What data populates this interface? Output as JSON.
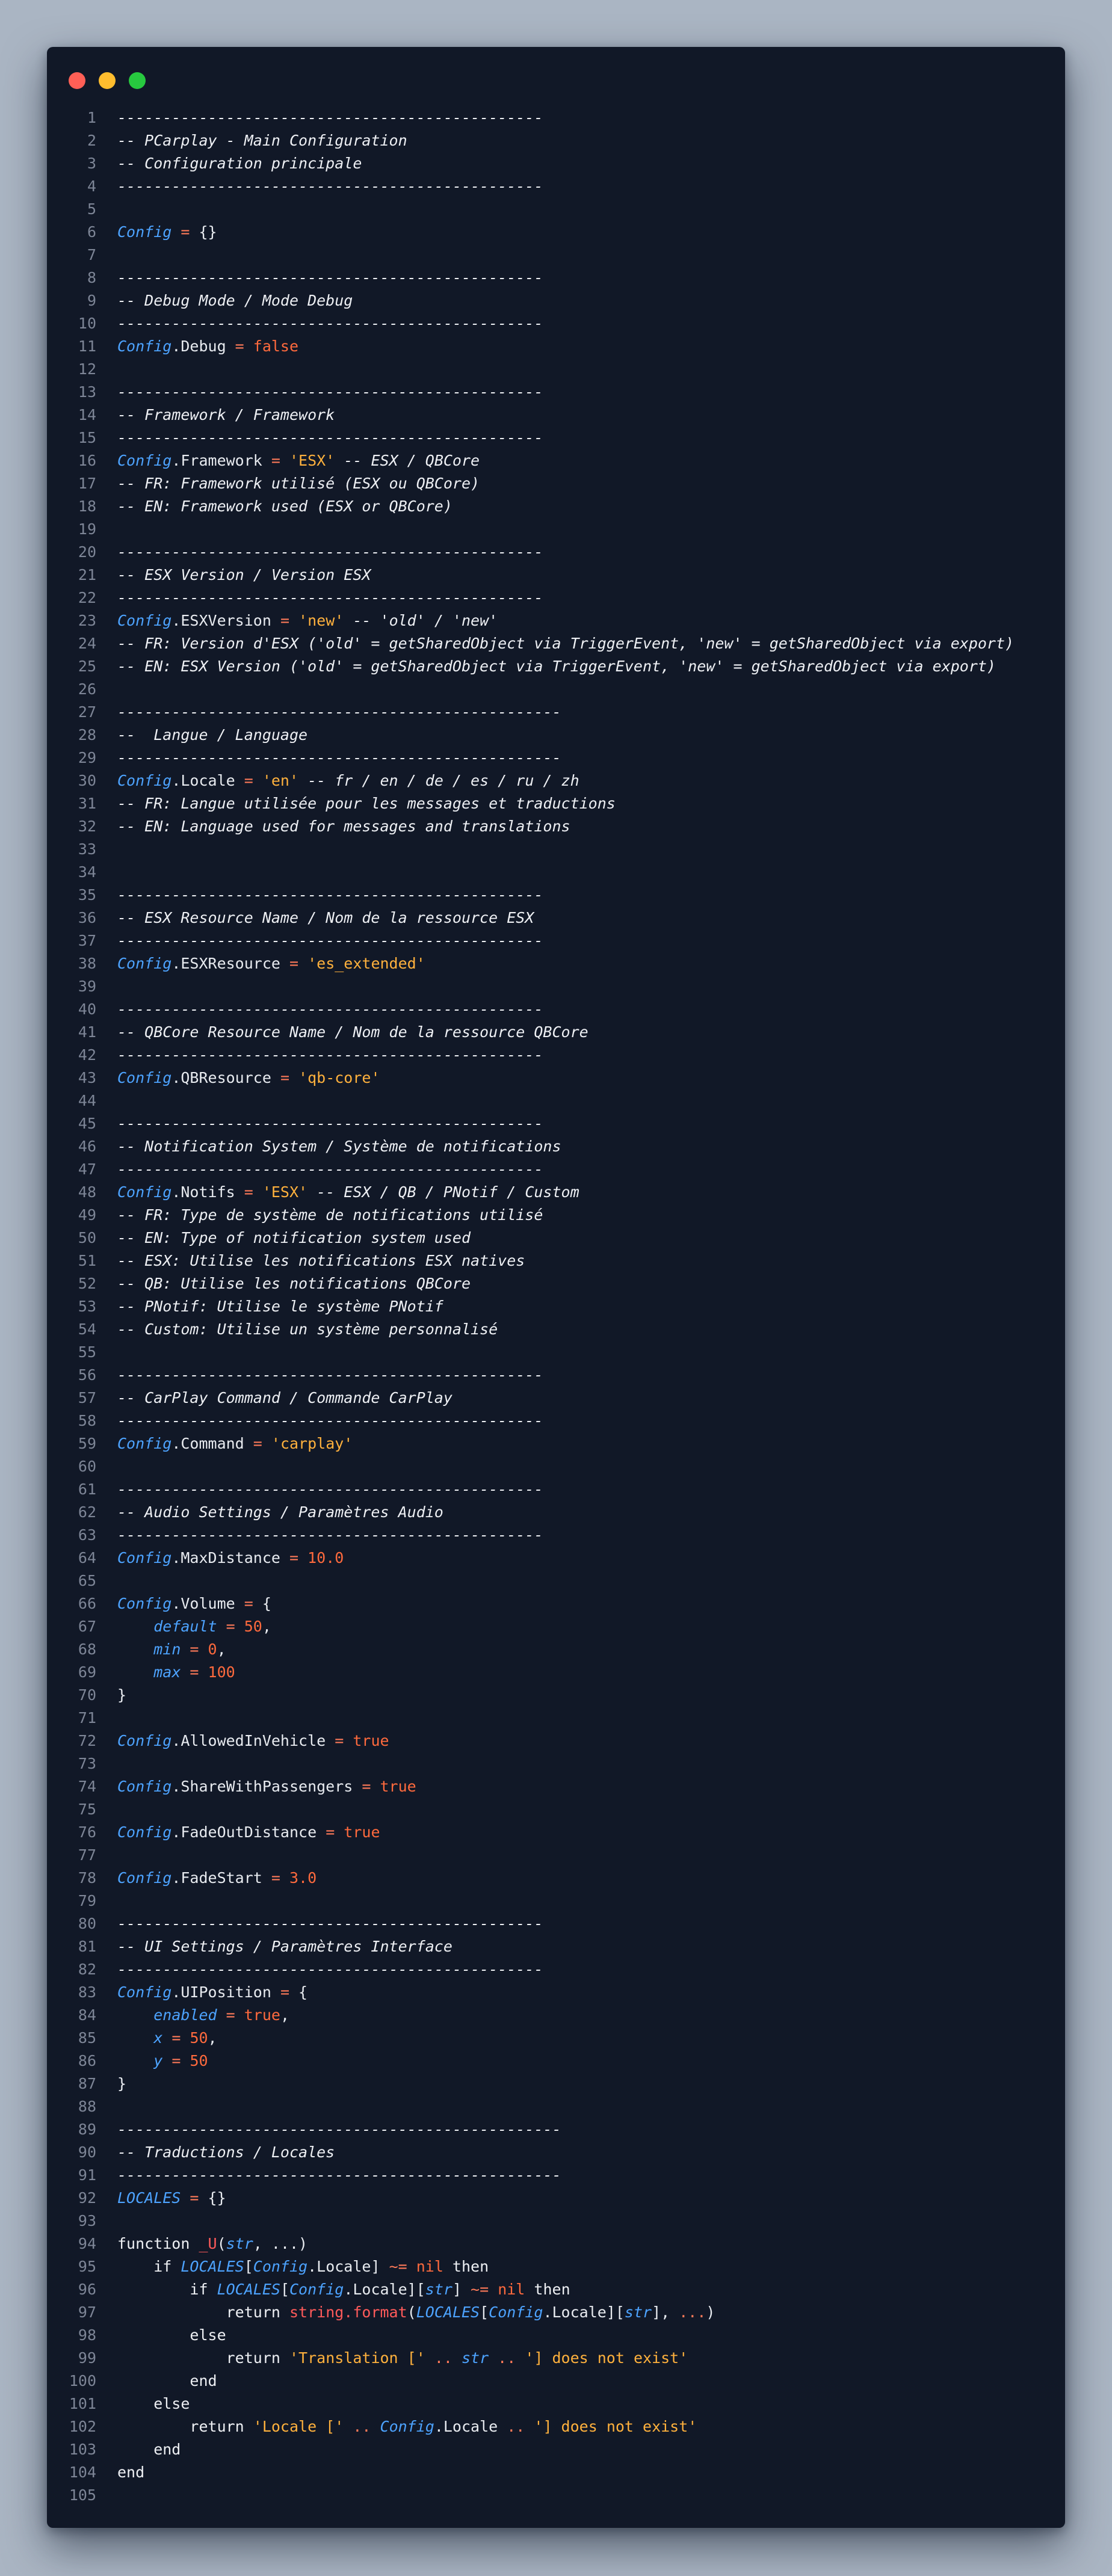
{
  "window": {
    "controls": [
      "close",
      "minimize",
      "maximize"
    ],
    "colors": {
      "close": "#ff5f56",
      "minimize": "#ffbd2e",
      "maximize": "#27c93f",
      "background": "#111827"
    }
  },
  "editor": {
    "lines": [
      [
        [
          "c",
          "-----------------------------------------------"
        ]
      ],
      [
        [
          "c",
          "-- PCarplay - Main Configuration"
        ]
      ],
      [
        [
          "c",
          "-- Configuration principale"
        ]
      ],
      [
        [
          "c",
          "-----------------------------------------------"
        ]
      ],
      [],
      [
        [
          "v",
          "Config"
        ],
        [
          "op",
          " = "
        ],
        [
          "p",
          "{}"
        ]
      ],
      [],
      [
        [
          "c",
          "-----------------------------------------------"
        ]
      ],
      [
        [
          "c",
          "-- Debug Mode / Mode Debug"
        ]
      ],
      [
        [
          "c",
          "-----------------------------------------------"
        ]
      ],
      [
        [
          "v",
          "Config"
        ],
        [
          "p",
          ".Debug"
        ],
        [
          "op",
          " = "
        ],
        [
          "k",
          "false"
        ]
      ],
      [],
      [
        [
          "c",
          "-----------------------------------------------"
        ]
      ],
      [
        [
          "c",
          "-- Framework / Framework"
        ]
      ],
      [
        [
          "c",
          "-----------------------------------------------"
        ]
      ],
      [
        [
          "v",
          "Config"
        ],
        [
          "p",
          ".Framework"
        ],
        [
          "op",
          " = "
        ],
        [
          "s",
          "'ESX'"
        ],
        [
          "c",
          " -- ESX / QBCore"
        ]
      ],
      [
        [
          "c",
          "-- FR: Framework utilisé (ESX ou QBCore)"
        ]
      ],
      [
        [
          "c",
          "-- EN: Framework used (ESX or QBCore)"
        ]
      ],
      [],
      [
        [
          "c",
          "-----------------------------------------------"
        ]
      ],
      [
        [
          "c",
          "-- ESX Version / Version ESX"
        ]
      ],
      [
        [
          "c",
          "-----------------------------------------------"
        ]
      ],
      [
        [
          "v",
          "Config"
        ],
        [
          "p",
          ".ESXVersion"
        ],
        [
          "op",
          " = "
        ],
        [
          "s",
          "'new'"
        ],
        [
          "c",
          " -- 'old' / 'new'"
        ]
      ],
      [
        [
          "c",
          "-- FR: Version d'ESX ('old' = getSharedObject via TriggerEvent, 'new' = getSharedObject via export)"
        ]
      ],
      [
        [
          "c",
          "-- EN: ESX Version ('old' = getSharedObject via TriggerEvent, 'new' = getSharedObject via export)"
        ]
      ],
      [],
      [
        [
          "c",
          "-------------------------------------------------"
        ]
      ],
      [
        [
          "c",
          "--  Langue / Language"
        ]
      ],
      [
        [
          "c",
          "-------------------------------------------------"
        ]
      ],
      [
        [
          "v",
          "Config"
        ],
        [
          "p",
          ".Locale"
        ],
        [
          "op",
          " = "
        ],
        [
          "s",
          "'en'"
        ],
        [
          "c",
          " -- fr / en / de / es / ru / zh"
        ]
      ],
      [
        [
          "c",
          "-- FR: Langue utilisée pour les messages et traductions"
        ]
      ],
      [
        [
          "c",
          "-- EN: Language used for messages and translations"
        ]
      ],
      [],
      [],
      [
        [
          "c",
          "-----------------------------------------------"
        ]
      ],
      [
        [
          "c",
          "-- ESX Resource Name / Nom de la ressource ESX"
        ]
      ],
      [
        [
          "c",
          "-----------------------------------------------"
        ]
      ],
      [
        [
          "v",
          "Config"
        ],
        [
          "p",
          ".ESXResource"
        ],
        [
          "op",
          " = "
        ],
        [
          "s",
          "'es_extended'"
        ]
      ],
      [],
      [
        [
          "c",
          "-----------------------------------------------"
        ]
      ],
      [
        [
          "c",
          "-- QBCore Resource Name / Nom de la ressource QBCore"
        ]
      ],
      [
        [
          "c",
          "-----------------------------------------------"
        ]
      ],
      [
        [
          "v",
          "Config"
        ],
        [
          "p",
          ".QBResource"
        ],
        [
          "op",
          " = "
        ],
        [
          "s",
          "'qb-core'"
        ]
      ],
      [],
      [
        [
          "c",
          "-----------------------------------------------"
        ]
      ],
      [
        [
          "c",
          "-- Notification System / Système de notifications"
        ]
      ],
      [
        [
          "c",
          "-----------------------------------------------"
        ]
      ],
      [
        [
          "v",
          "Config"
        ],
        [
          "p",
          ".Notifs"
        ],
        [
          "op",
          " = "
        ],
        [
          "s",
          "'ESX'"
        ],
        [
          "c",
          " -- ESX / QB / PNotif / Custom"
        ]
      ],
      [
        [
          "c",
          "-- FR: Type de système de notifications utilisé"
        ]
      ],
      [
        [
          "c",
          "-- EN: Type of notification system used"
        ]
      ],
      [
        [
          "c",
          "-- ESX: Utilise les notifications ESX natives"
        ]
      ],
      [
        [
          "c",
          "-- QB: Utilise les notifications QBCore"
        ]
      ],
      [
        [
          "c",
          "-- PNotif: Utilise le système PNotif"
        ]
      ],
      [
        [
          "c",
          "-- Custom: Utilise un système personnalisé"
        ]
      ],
      [],
      [
        [
          "c",
          "-----------------------------------------------"
        ]
      ],
      [
        [
          "c",
          "-- CarPlay Command / Commande CarPlay"
        ]
      ],
      [
        [
          "c",
          "-----------------------------------------------"
        ]
      ],
      [
        [
          "v",
          "Config"
        ],
        [
          "p",
          ".Command"
        ],
        [
          "op",
          " = "
        ],
        [
          "s",
          "'carplay'"
        ]
      ],
      [],
      [
        [
          "c",
          "-----------------------------------------------"
        ]
      ],
      [
        [
          "c",
          "-- Audio Settings / Paramètres Audio"
        ]
      ],
      [
        [
          "c",
          "-----------------------------------------------"
        ]
      ],
      [
        [
          "v",
          "Config"
        ],
        [
          "p",
          ".MaxDistance"
        ],
        [
          "op",
          " = "
        ],
        [
          "n",
          "10.0"
        ]
      ],
      [],
      [
        [
          "v",
          "Config"
        ],
        [
          "p",
          ".Volume"
        ],
        [
          "op",
          " = "
        ],
        [
          "p",
          "{"
        ]
      ],
      [
        [
          "p",
          "    "
        ],
        [
          "v",
          "default"
        ],
        [
          "op",
          " = "
        ],
        [
          "n",
          "50"
        ],
        [
          "p",
          ","
        ]
      ],
      [
        [
          "p",
          "    "
        ],
        [
          "v",
          "min"
        ],
        [
          "op",
          " = "
        ],
        [
          "n",
          "0"
        ],
        [
          "p",
          ","
        ]
      ],
      [
        [
          "p",
          "    "
        ],
        [
          "v",
          "max"
        ],
        [
          "op",
          " = "
        ],
        [
          "n",
          "100"
        ]
      ],
      [
        [
          "p",
          "}"
        ]
      ],
      [],
      [
        [
          "v",
          "Config"
        ],
        [
          "p",
          ".AllowedInVehicle"
        ],
        [
          "op",
          " = "
        ],
        [
          "k",
          "true"
        ]
      ],
      [],
      [
        [
          "v",
          "Config"
        ],
        [
          "p",
          ".ShareWithPassengers"
        ],
        [
          "op",
          " = "
        ],
        [
          "k",
          "true"
        ]
      ],
      [],
      [
        [
          "v",
          "Config"
        ],
        [
          "p",
          ".FadeOutDistance"
        ],
        [
          "op",
          " = "
        ],
        [
          "k",
          "true"
        ]
      ],
      [],
      [
        [
          "v",
          "Config"
        ],
        [
          "p",
          ".FadeStart"
        ],
        [
          "op",
          " = "
        ],
        [
          "n",
          "3.0"
        ]
      ],
      [],
      [
        [
          "c",
          "-----------------------------------------------"
        ]
      ],
      [
        [
          "c",
          "-- UI Settings / Paramètres Interface"
        ]
      ],
      [
        [
          "c",
          "-----------------------------------------------"
        ]
      ],
      [
        [
          "v",
          "Config"
        ],
        [
          "p",
          ".UIPosition"
        ],
        [
          "op",
          " = "
        ],
        [
          "p",
          "{"
        ]
      ],
      [
        [
          "p",
          "    "
        ],
        [
          "v",
          "enabled"
        ],
        [
          "op",
          " = "
        ],
        [
          "k",
          "true"
        ],
        [
          "p",
          ","
        ]
      ],
      [
        [
          "p",
          "    "
        ],
        [
          "v",
          "x"
        ],
        [
          "op",
          " = "
        ],
        [
          "n",
          "50"
        ],
        [
          "p",
          ","
        ]
      ],
      [
        [
          "p",
          "    "
        ],
        [
          "v",
          "y"
        ],
        [
          "op",
          " = "
        ],
        [
          "n",
          "50"
        ]
      ],
      [
        [
          "p",
          "}"
        ]
      ],
      [],
      [
        [
          "c",
          "-------------------------------------------------"
        ]
      ],
      [
        [
          "c",
          "-- Traductions / Locales"
        ]
      ],
      [
        [
          "c",
          "-------------------------------------------------"
        ]
      ],
      [
        [
          "v",
          "LOCALES"
        ],
        [
          "op",
          " = "
        ],
        [
          "p",
          "{}"
        ]
      ],
      [],
      [
        [
          "kw",
          "function "
        ],
        [
          "fn",
          "_U"
        ],
        [
          "p",
          "("
        ],
        [
          "v",
          "str"
        ],
        [
          "p",
          ", ...)"
        ]
      ],
      [
        [
          "kw",
          "    if "
        ],
        [
          "v",
          "LOCALES"
        ],
        [
          "p",
          "["
        ],
        [
          "v",
          "Config"
        ],
        [
          "p",
          ".Locale] "
        ],
        [
          "op",
          "~= "
        ],
        [
          "k",
          "nil"
        ],
        [
          "kw",
          " then"
        ]
      ],
      [
        [
          "kw",
          "        if "
        ],
        [
          "v",
          "LOCALES"
        ],
        [
          "p",
          "["
        ],
        [
          "v",
          "Config"
        ],
        [
          "p",
          ".Locale]["
        ],
        [
          "v",
          "str"
        ],
        [
          "p",
          "] "
        ],
        [
          "op",
          "~= "
        ],
        [
          "k",
          "nil"
        ],
        [
          "kw",
          " then"
        ]
      ],
      [
        [
          "kw",
          "            return "
        ],
        [
          "fn",
          "string.format"
        ],
        [
          "p",
          "("
        ],
        [
          "v",
          "LOCALES"
        ],
        [
          "p",
          "["
        ],
        [
          "v",
          "Config"
        ],
        [
          "p",
          ".Locale]["
        ],
        [
          "v",
          "str"
        ],
        [
          "p",
          "], "
        ],
        [
          "op",
          "..."
        ],
        [
          "p",
          ")"
        ]
      ],
      [
        [
          "kw",
          "        else"
        ]
      ],
      [
        [
          "kw",
          "            return "
        ],
        [
          "s",
          "'Translation [' "
        ],
        [
          "op",
          ".. "
        ],
        [
          "v",
          "str"
        ],
        [
          "op",
          " .. "
        ],
        [
          "s",
          "'] does not exist'"
        ]
      ],
      [
        [
          "kw",
          "        end"
        ]
      ],
      [
        [
          "kw",
          "    else"
        ]
      ],
      [
        [
          "kw",
          "        return "
        ],
        [
          "s",
          "'Locale [' "
        ],
        [
          "op",
          ".. "
        ],
        [
          "v",
          "Config"
        ],
        [
          "p",
          ".Locale"
        ],
        [
          "op",
          " .. "
        ],
        [
          "s",
          "'] does not exist'"
        ]
      ],
      [
        [
          "kw",
          "    end"
        ]
      ],
      [
        [
          "kw",
          "end"
        ]
      ],
      []
    ]
  }
}
